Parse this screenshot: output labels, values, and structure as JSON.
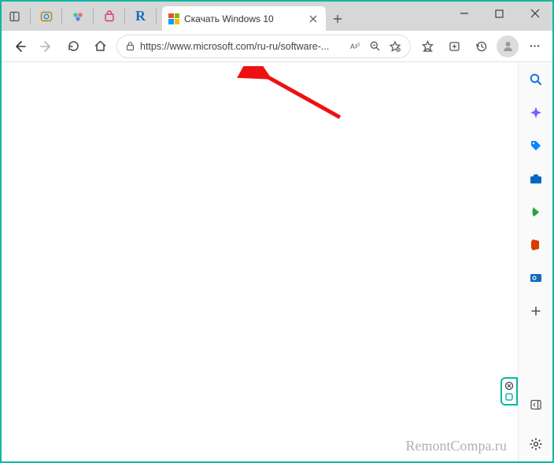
{
  "tab": {
    "title": "Скачать Windows 10"
  },
  "address": {
    "url": "https://www.microsoft.com/ru-ru/software-..."
  },
  "watermark": "RemontCompa.ru",
  "taskbar_R": "R"
}
